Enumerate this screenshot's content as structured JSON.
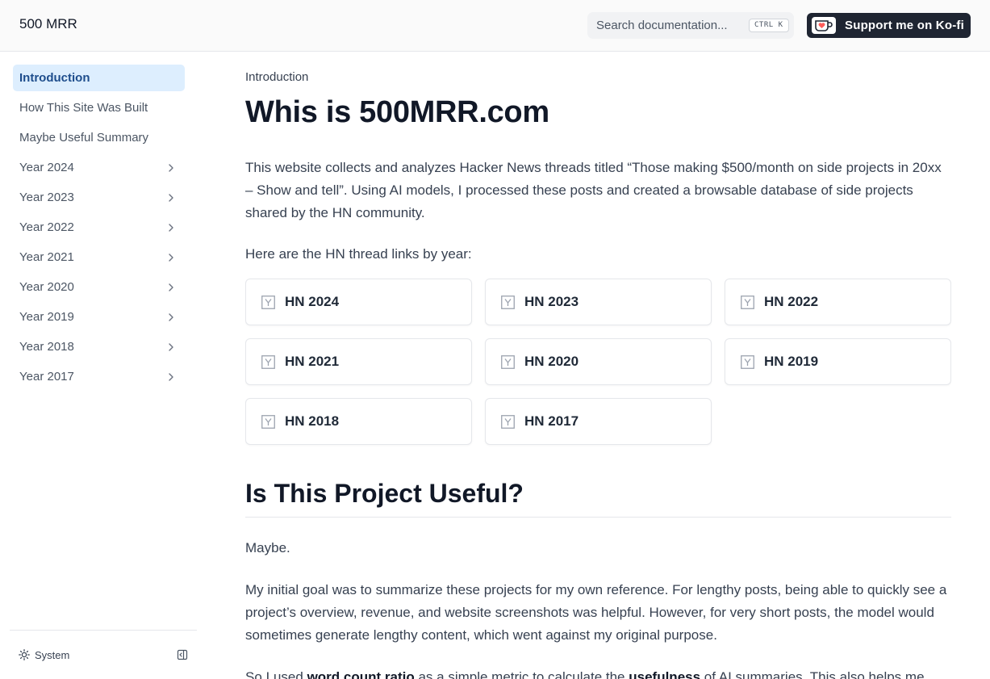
{
  "header": {
    "brand": "500 MRR",
    "search_placeholder": "Search documentation...",
    "shortcut": "CTRL K",
    "kofi_label": "Support me on Ko-fi"
  },
  "sidebar": {
    "items": [
      {
        "label": "Introduction"
      },
      {
        "label": "How This Site Was Built"
      },
      {
        "label": "Maybe Useful Summary"
      },
      {
        "label": "Year 2024"
      },
      {
        "label": "Year 2023"
      },
      {
        "label": "Year 2022"
      },
      {
        "label": "Year 2021"
      },
      {
        "label": "Year 2020"
      },
      {
        "label": "Year 2019"
      },
      {
        "label": "Year 2018"
      },
      {
        "label": "Year 2017"
      }
    ],
    "theme_label": "System"
  },
  "main": {
    "breadcrumb": "Introduction",
    "title": "Whis is 500MRR.com",
    "intro": "This website collects and analyzes Hacker News threads titled “Those making $500/month on side projects in 20xx – Show and tell”. Using AI models, I processed these posts and created a browsable database of side projects shared by the HN community.",
    "links_intro": "Here are the HN thread links by year:",
    "cards": [
      {
        "label": "HN 2024"
      },
      {
        "label": "HN 2023"
      },
      {
        "label": "HN 2022"
      },
      {
        "label": "HN 2021"
      },
      {
        "label": "HN 2020"
      },
      {
        "label": "HN 2019"
      },
      {
        "label": "HN 2018"
      },
      {
        "label": "HN 2017"
      }
    ],
    "section_title": "Is This Project Useful?",
    "maybe": "Maybe.",
    "goal_text": "My initial goal was to summarize these projects for my own reference. For lengthy posts, being able to quickly see a project’s overview, revenue, and website screenshots was helpful. However, for very short posts, the model would sometimes generate lengthy content, which went against my original purpose.",
    "last_pre": "So I used ",
    "last_bold1": "word count ratio",
    "last_mid": " as a simple metric to calculate the ",
    "last_bold2": "usefulness",
    "last_post": " of AI summaries. This also helps me"
  }
}
